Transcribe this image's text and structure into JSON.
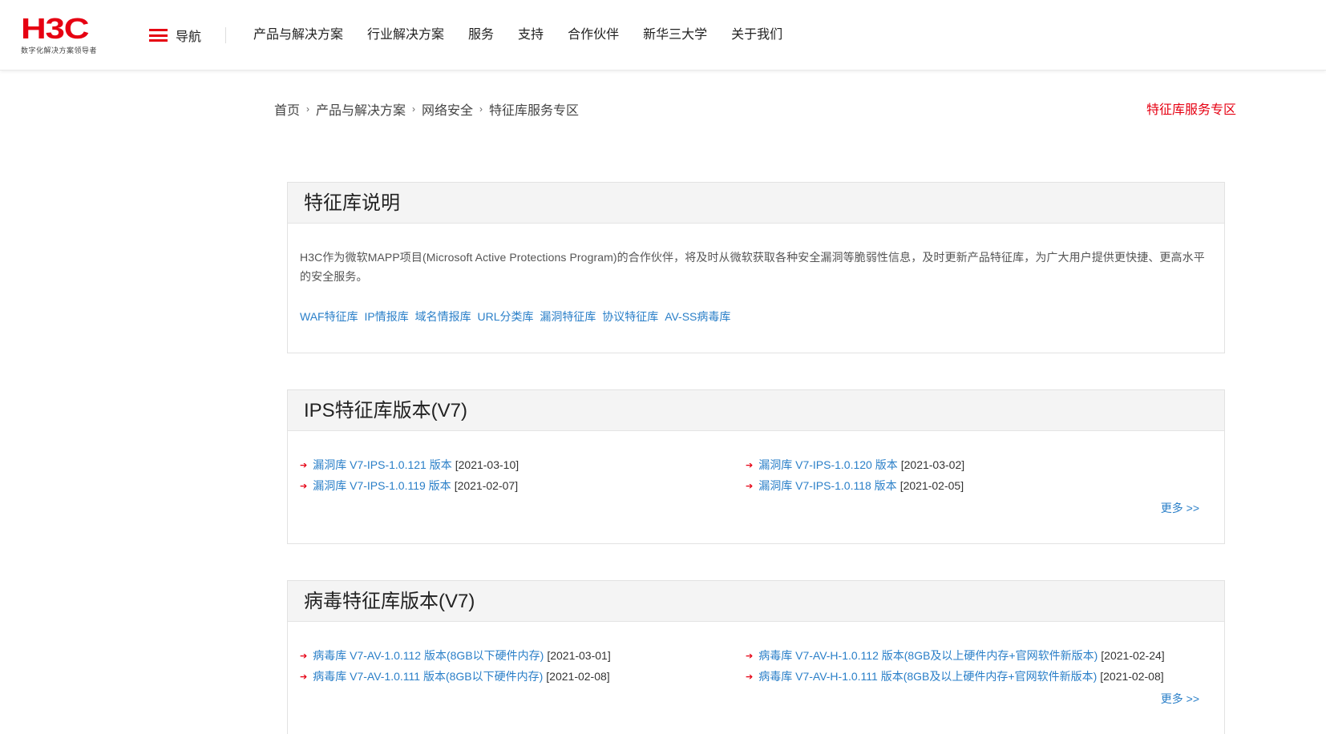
{
  "header": {
    "logo_text": "H3C",
    "logo_tagline": "数字化解决方案领导者",
    "nav_toggle_label": "导航",
    "nav": [
      "产品与解决方案",
      "行业解决方案",
      "服务",
      "支持",
      "合作伙伴",
      "新华三大学",
      "关于我们"
    ]
  },
  "breadcrumb": [
    "首页",
    "产品与解决方案",
    "网络安全",
    "特征库服务专区"
  ],
  "page_tag": "特征库服务专区",
  "intro": {
    "title": "特征库说明",
    "description": "H3C作为微软MAPP项目(Microsoft Active Protections Program)的合作伙伴，将及时从微软获取各种安全漏洞等脆弱性信息，及时更新产品特征库，为广大用户提供更快捷、更高水平的安全服务。",
    "links": [
      "WAF特征库",
      "IP情报库",
      "域名情报库",
      "URL分类库",
      "漏洞特征库",
      "协议特征库",
      "AV-SS病毒库"
    ]
  },
  "ips": {
    "title": "IPS特征库版本(V7)",
    "items": [
      {
        "label": "漏洞库 V7-IPS-1.0.121 版本",
        "date": "[2021-03-10]"
      },
      {
        "label": "漏洞库 V7-IPS-1.0.120 版本",
        "date": "[2021-03-02]"
      },
      {
        "label": "漏洞库 V7-IPS-1.0.119 版本",
        "date": "[2021-02-07]"
      },
      {
        "label": "漏洞库 V7-IPS-1.0.118 版本",
        "date": "[2021-02-05]"
      }
    ],
    "more": "更多 >>"
  },
  "av": {
    "title": "病毒特征库版本(V7)",
    "items": [
      {
        "label": "病毒库 V7-AV-1.0.112 版本(8GB以下硬件内存)",
        "date": "[2021-03-01]"
      },
      {
        "label": "病毒库 V7-AV-H-1.0.112 版本(8GB及以上硬件内存+官网软件新版本)",
        "date": "[2021-02-24]"
      },
      {
        "label": "病毒库 V7-AV-1.0.111 版本(8GB以下硬件内存)",
        "date": "[2021-02-08]"
      },
      {
        "label": "病毒库 V7-AV-H-1.0.111 版本(8GB及以上硬件内存+官网软件新版本)",
        "date": "[2021-02-08]"
      }
    ],
    "more": "更多 >>"
  },
  "colors": {
    "brand_red": "#e60012",
    "link_blue": "#2a7fc8"
  }
}
